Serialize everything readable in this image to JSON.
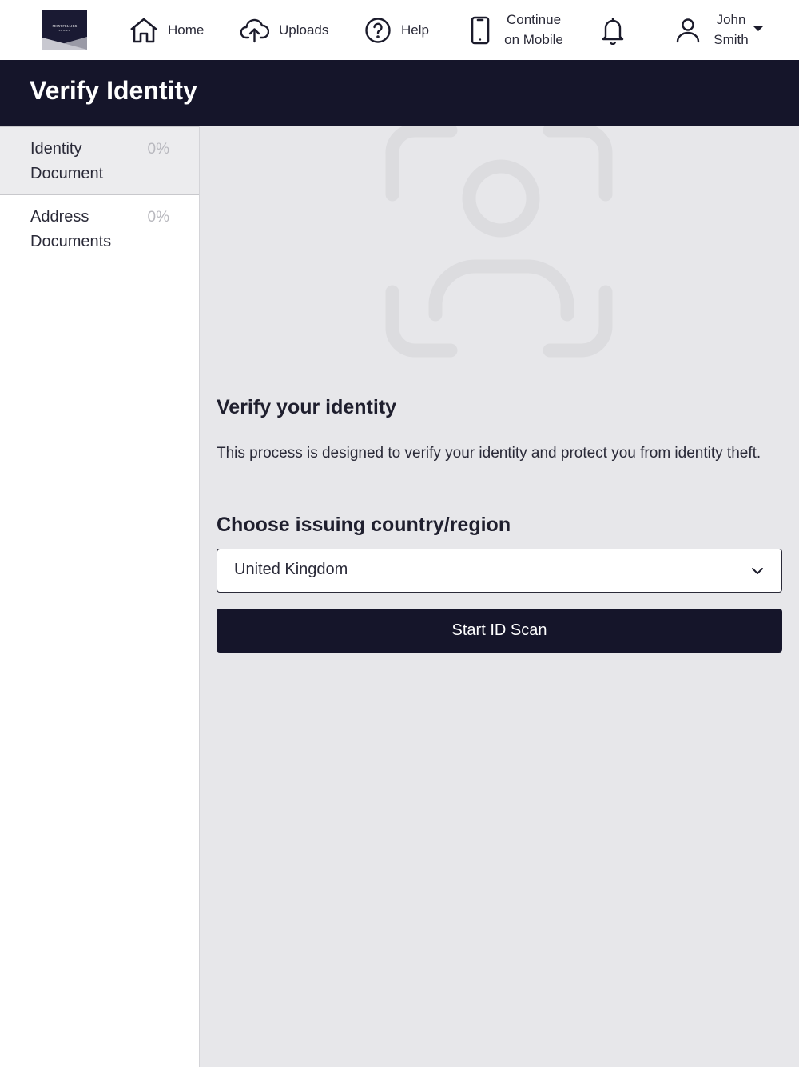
{
  "logo": {
    "text": "MONTPELLIER",
    "sub": "LEGAL"
  },
  "nav": {
    "home": {
      "label": "Home",
      "icon": "home-icon"
    },
    "uploads": {
      "label": "Uploads",
      "icon": "cloud-upload-icon"
    },
    "help": {
      "label": "Help",
      "icon": "help-circle-icon"
    },
    "mobile": {
      "label": "Continue on Mobile",
      "icon": "mobile-phone-icon"
    },
    "notifications": {
      "icon": "bell-icon"
    },
    "user": {
      "label": "John Smith",
      "icon": "user-icon"
    }
  },
  "header": {
    "title": "Verify Identity"
  },
  "sidebar": {
    "items": [
      {
        "label": "Identity Document",
        "progress": "0%",
        "active": true
      },
      {
        "label": "Address Documents",
        "progress": "0%",
        "active": false
      }
    ]
  },
  "main": {
    "hero_icon": "face-scan-icon",
    "heading": "Verify your identity",
    "description": "This process is designed to verify your identity and protect you from identity theft.",
    "country_heading": "Choose issuing country/region",
    "country_select": {
      "value": "United Kingdom"
    },
    "start_button": "Start ID Scan"
  },
  "colors": {
    "brand_dark": "#15152a",
    "panel_bg": "#e7e7ea",
    "muted": "#b8b8be"
  }
}
